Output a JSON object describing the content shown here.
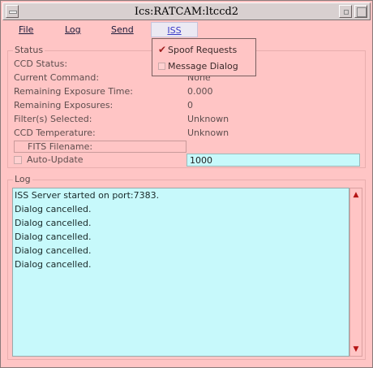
{
  "window": {
    "title": "Ics:RATCAM:ltccd2"
  },
  "menubar": {
    "file": "File",
    "log": "Log",
    "send": "Send",
    "iss": "ISS"
  },
  "iss_menu": {
    "items": [
      {
        "label": "Spoof Requests",
        "checked": true
      },
      {
        "label": "Message Dialog",
        "checked": false
      }
    ]
  },
  "status": {
    "group_label": "Status",
    "rows": [
      {
        "label": "CCD Status:",
        "value": ""
      },
      {
        "label": "Current Command:",
        "value": "None"
      },
      {
        "label": "Remaining Exposure Time:",
        "value": "0.000"
      },
      {
        "label": "Remaining Exposures:",
        "value": "0"
      },
      {
        "label": "Filter(s) Selected:",
        "value": "Unknown"
      },
      {
        "label": "CCD Temperature:",
        "value": "Unknown"
      }
    ],
    "fits_filename_label": "FITS Filename:",
    "auto_update_label": "Auto-Update",
    "auto_update_checked": false,
    "auto_update_value": "1000"
  },
  "log": {
    "group_label": "Log",
    "lines": [
      "ISS Server started on port:7383.",
      "Dialog cancelled.",
      "Dialog cancelled.",
      "Dialog cancelled.",
      "Dialog cancelled.",
      "Dialog cancelled."
    ]
  },
  "icons": {
    "window_menu": "window-menu-icon",
    "minimize": "minimize-icon",
    "maximize": "maximize-icon",
    "scroll_up": "scroll-up-arrow-icon",
    "scroll_down": "scroll-down-arrow-icon",
    "check": "checkmark-icon"
  }
}
